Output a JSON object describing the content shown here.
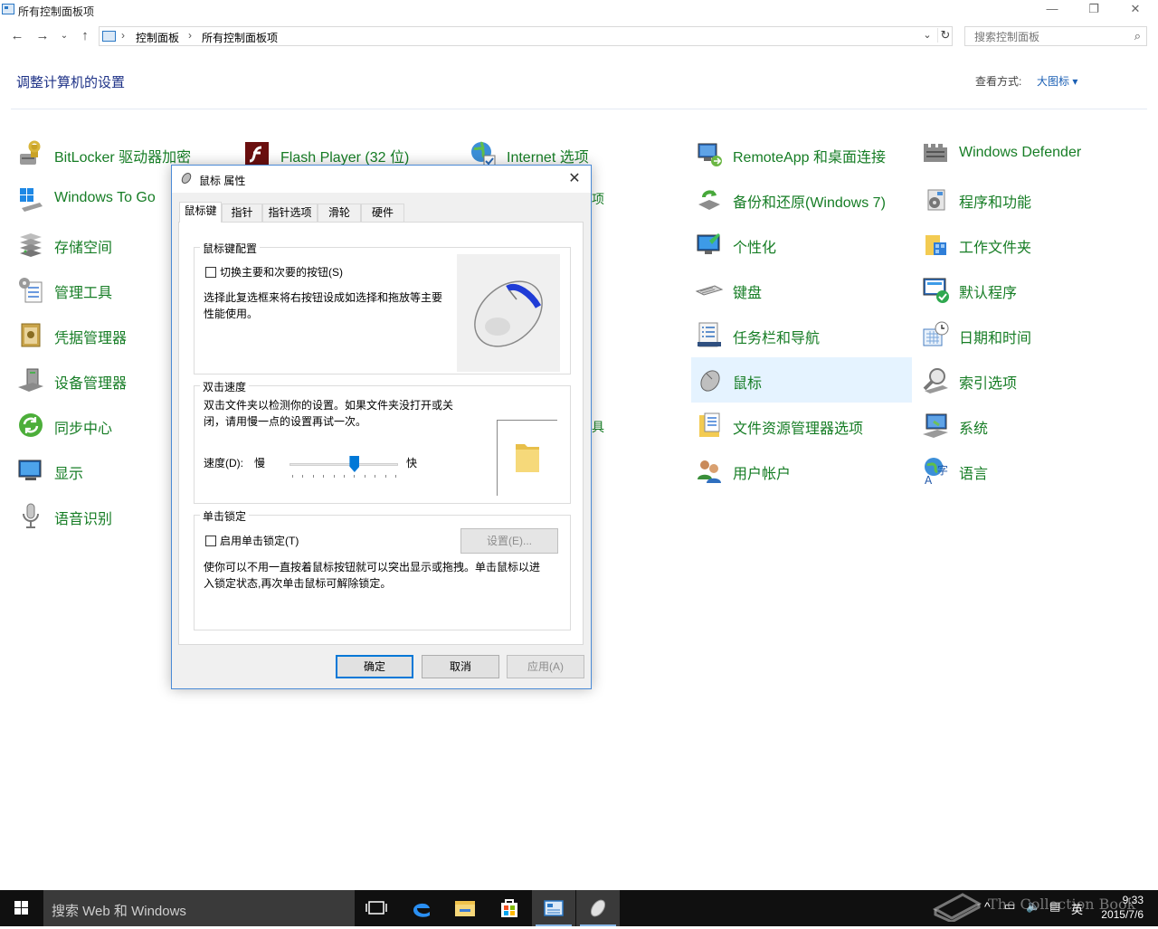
{
  "window": {
    "title": "所有控制面板项",
    "controls": [
      "minimize",
      "maximize",
      "close"
    ]
  },
  "address_bar": {
    "breadcrumbs": [
      "控制面板",
      "所有控制面板项"
    ],
    "search_placeholder": "搜索控制面板"
  },
  "header": {
    "title": "调整计算机的设置",
    "view_by_label": "查看方式:",
    "view_by_value": "大图标 ▾"
  },
  "items": [
    {
      "label": "BitLocker 驱动器加密",
      "icon": "bitlocker-icon"
    },
    {
      "label": "Flash Player (32 位)",
      "icon": "flash-icon"
    },
    {
      "label": "Internet 选项",
      "icon": "internet-icon"
    },
    {
      "label": "RemoteApp 和桌面连接",
      "icon": "remoteapp-icon"
    },
    {
      "label": "Windows Defender",
      "icon": "defender-icon"
    },
    {
      "label": "Windows To Go",
      "icon": "windows-to-go-icon"
    },
    {
      "label": "备份和还原(Windows 7)",
      "icon": "backup-icon"
    },
    {
      "label": "程序和功能",
      "icon": "programs-icon"
    },
    {
      "label": "存储空间",
      "icon": "storage-icon"
    },
    {
      "label": "个性化",
      "icon": "personalize-icon"
    },
    {
      "label": "工作文件夹",
      "icon": "work-folders-icon"
    },
    {
      "label": "管理工具",
      "icon": "admin-tools-icon"
    },
    {
      "label": "键盘",
      "icon": "keyboard-icon"
    },
    {
      "label": "默认程序",
      "icon": "default-programs-icon"
    },
    {
      "label": "凭据管理器",
      "icon": "credential-icon"
    },
    {
      "label": "任务栏和导航",
      "icon": "taskbar-icon"
    },
    {
      "label": "日期和时间",
      "icon": "datetime-icon"
    },
    {
      "label": "设备管理器",
      "icon": "device-manager-icon"
    },
    {
      "label": "鼠标",
      "icon": "mouse-icon"
    },
    {
      "label": "索引选项",
      "icon": "index-icon"
    },
    {
      "label": "同步中心",
      "icon": "sync-icon"
    },
    {
      "label": "文件资源管理器选项",
      "icon": "explorer-options-icon"
    },
    {
      "label": "系统",
      "icon": "system-icon"
    },
    {
      "label": "显示",
      "icon": "display-icon"
    },
    {
      "label": "用户帐户",
      "icon": "user-accounts-icon"
    },
    {
      "label": "语言",
      "icon": "language-icon"
    },
    {
      "label": "语音识别",
      "icon": "speech-icon"
    }
  ],
  "hidden_fragments": [
    "项",
    "具"
  ],
  "dialog": {
    "title": "鼠标 属性",
    "tabs": [
      "鼠标键",
      "指针",
      "指针选项",
      "滑轮",
      "硬件"
    ],
    "active_tab": "鼠标键",
    "button_config": {
      "legend": "鼠标键配置",
      "checkbox_label": "切换主要和次要的按钮(S)",
      "checked": false,
      "description_line1": "选择此复选框来将右按钮设成如选择和拖放等主要",
      "description_line2": "性能使用。"
    },
    "double_click": {
      "legend": "双击速度",
      "description_line1": "双击文件夹以检测你的设置。如果文件夹没打开或关",
      "description_line2": "闭，请用慢一点的设置再试一次。",
      "speed_label": "速度(D):",
      "slow_label": "慢",
      "fast_label": "快",
      "speed_position": 0.6,
      "tick_count": 11
    },
    "click_lock": {
      "legend": "单击锁定",
      "checkbox_label": "启用单击锁定(T)",
      "checked": false,
      "settings_button": "设置(E)...",
      "description_line1": "使你可以不用一直按着鼠标按钮就可以突出显示或拖拽。单击鼠标以进",
      "description_line2": "入锁定状态,再次单击鼠标可解除锁定。"
    },
    "buttons": {
      "ok": "确定",
      "cancel": "取消",
      "apply": "应用(A)"
    }
  },
  "taskbar": {
    "search_placeholder": "搜索 Web 和 Windows",
    "tray_ime": "英",
    "time": "9:33",
    "date": "2015/7/6"
  },
  "watermark": "The Collection Book",
  "colors": {
    "item_label": "#167d25",
    "heading": "#1e3287",
    "link": "#1a5fb4",
    "accent": "#0078d7",
    "selected_bg": "#e5f3ff"
  }
}
